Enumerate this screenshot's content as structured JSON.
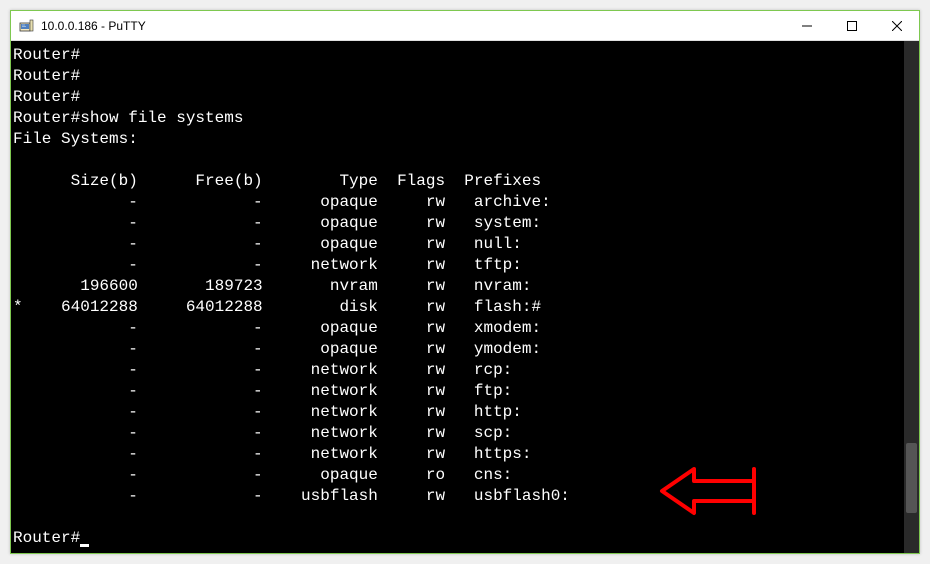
{
  "window": {
    "title": "10.0.0.186 - PuTTY"
  },
  "terminal": {
    "prompt": "Router#",
    "command": "show file systems",
    "header": "File Systems:",
    "columns": {
      "size": "Size(b)",
      "free": "Free(b)",
      "type": "Type",
      "flags": "Flags",
      "prefixes": "Prefixes"
    },
    "rows": [
      {
        "star": " ",
        "size": "-",
        "free": "-",
        "type": "opaque",
        "flags": "rw",
        "prefixes": "archive:"
      },
      {
        "star": " ",
        "size": "-",
        "free": "-",
        "type": "opaque",
        "flags": "rw",
        "prefixes": "system:"
      },
      {
        "star": " ",
        "size": "-",
        "free": "-",
        "type": "opaque",
        "flags": "rw",
        "prefixes": "null:"
      },
      {
        "star": " ",
        "size": "-",
        "free": "-",
        "type": "network",
        "flags": "rw",
        "prefixes": "tftp:"
      },
      {
        "star": " ",
        "size": "196600",
        "free": "189723",
        "type": "nvram",
        "flags": "rw",
        "prefixes": "nvram:"
      },
      {
        "star": "*",
        "size": "64012288",
        "free": "64012288",
        "type": "disk",
        "flags": "rw",
        "prefixes": "flash:#"
      },
      {
        "star": " ",
        "size": "-",
        "free": "-",
        "type": "opaque",
        "flags": "rw",
        "prefixes": "xmodem:"
      },
      {
        "star": " ",
        "size": "-",
        "free": "-",
        "type": "opaque",
        "flags": "rw",
        "prefixes": "ymodem:"
      },
      {
        "star": " ",
        "size": "-",
        "free": "-",
        "type": "network",
        "flags": "rw",
        "prefixes": "rcp:"
      },
      {
        "star": " ",
        "size": "-",
        "free": "-",
        "type": "network",
        "flags": "rw",
        "prefixes": "ftp:"
      },
      {
        "star": " ",
        "size": "-",
        "free": "-",
        "type": "network",
        "flags": "rw",
        "prefixes": "http:"
      },
      {
        "star": " ",
        "size": "-",
        "free": "-",
        "type": "network",
        "flags": "rw",
        "prefixes": "scp:"
      },
      {
        "star": " ",
        "size": "-",
        "free": "-",
        "type": "network",
        "flags": "rw",
        "prefixes": "https:"
      },
      {
        "star": " ",
        "size": "-",
        "free": "-",
        "type": "opaque",
        "flags": "ro",
        "prefixes": "cns:"
      },
      {
        "star": " ",
        "size": "-",
        "free": "-",
        "type": "usbflash",
        "flags": "rw",
        "prefixes": "usbflash0:"
      }
    ]
  }
}
